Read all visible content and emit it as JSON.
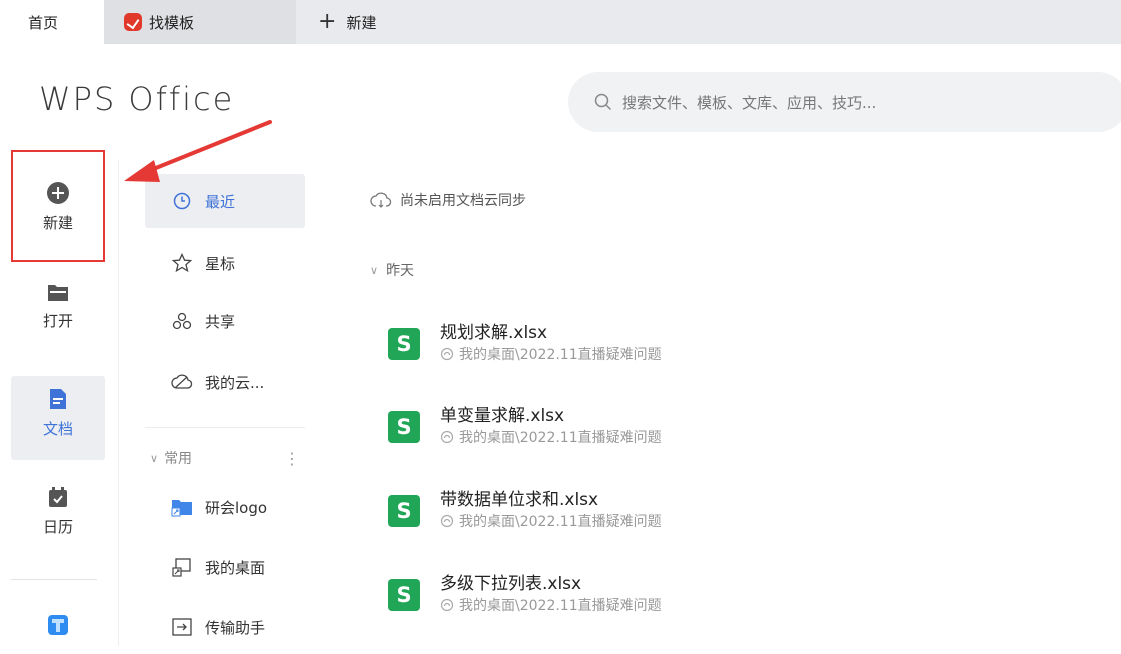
{
  "tabs": {
    "home": "首页",
    "templates": "找模板",
    "new_tab": "新建"
  },
  "header": {
    "brand": "WPS Office",
    "search_placeholder": "搜索文件、模板、文库、应用、技巧..."
  },
  "rail": {
    "new": "新建",
    "open": "打开",
    "docs": "文档",
    "calendar": "日历"
  },
  "nav": {
    "recent": "最近",
    "starred": "星标",
    "shared": "共享",
    "my_cloud": "我的云...",
    "common_header": "常用",
    "common_more": "⋮",
    "folders": [
      "研会logo",
      "我的桌面",
      "传输助手"
    ]
  },
  "main": {
    "sync_status": "尚未启用文档云同步",
    "group_label": "昨天",
    "files": [
      {
        "name": "规划求解.xlsx",
        "path": "我的桌面\\2022.11直播疑难问题"
      },
      {
        "name": "单变量求解.xlsx",
        "path": "我的桌面\\2022.11直播疑难问题"
      },
      {
        "name": "带数据单位求和.xlsx",
        "path": "我的桌面\\2022.11直播疑难问题"
      },
      {
        "name": "多级下拉列表.xlsx",
        "path": "我的桌面\\2022.11直播疑难问题"
      }
    ]
  },
  "colors": {
    "accent_blue": "#3f73d8",
    "excel_green": "#20a656",
    "annotation_red": "#e53935",
    "template_logo_red": "#e0382b"
  },
  "icons": {
    "file_type": "spreadsheet-icon",
    "file_type_glyph": "S"
  }
}
